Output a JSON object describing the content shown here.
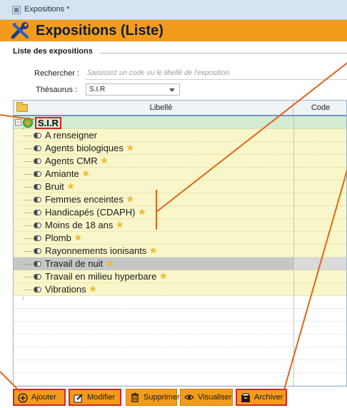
{
  "window": {
    "title": "Expositions *"
  },
  "header": {
    "title": "Expositions (Liste)"
  },
  "group": {
    "label": "Liste des expositions"
  },
  "search": {
    "label": "Rechercher :",
    "placeholder": "Saisissez un code ou le libellé de l'exposition"
  },
  "thesaurus": {
    "label": "Thésaurus :",
    "value": "S.I.R"
  },
  "table": {
    "columns": {
      "libelle": "Libellé",
      "code": "Code"
    },
    "root": "S.I.R",
    "items": [
      {
        "label": "A renseigner",
        "starred": false,
        "selected": false
      },
      {
        "label": "Agents biologiques",
        "starred": true,
        "selected": false
      },
      {
        "label": "Agents CMR",
        "starred": true,
        "selected": false
      },
      {
        "label": "Amiante",
        "starred": true,
        "selected": false
      },
      {
        "label": "Bruit",
        "starred": true,
        "selected": false
      },
      {
        "label": "Femmes enceintes",
        "starred": true,
        "selected": false
      },
      {
        "label": "Handicapés (CDAPH)",
        "starred": true,
        "selected": false
      },
      {
        "label": "Moins de 18 ans",
        "starred": true,
        "selected": false
      },
      {
        "label": "Plomb",
        "starred": true,
        "selected": false
      },
      {
        "label": "Rayonnements ionisants",
        "starred": true,
        "selected": false
      },
      {
        "label": "Travail de nuit",
        "starred": true,
        "selected": true
      },
      {
        "label": "Travail en milieu hyperbare",
        "starred": true,
        "selected": false
      },
      {
        "label": "Vibrations",
        "starred": true,
        "selected": false
      }
    ]
  },
  "toolbar": {
    "ajouter": "Ajouter",
    "modifier": "Modifier",
    "supprimer": "Supprimer",
    "visualiser": "Visualiser",
    "archiver": "Archiver"
  },
  "colors": {
    "header_bg": "#f39c1c",
    "annotation": "#d4242b",
    "row_yellow": "#f9f7c9",
    "row_root": "#d3ebd1",
    "row_selected": "#c6c6c6"
  }
}
